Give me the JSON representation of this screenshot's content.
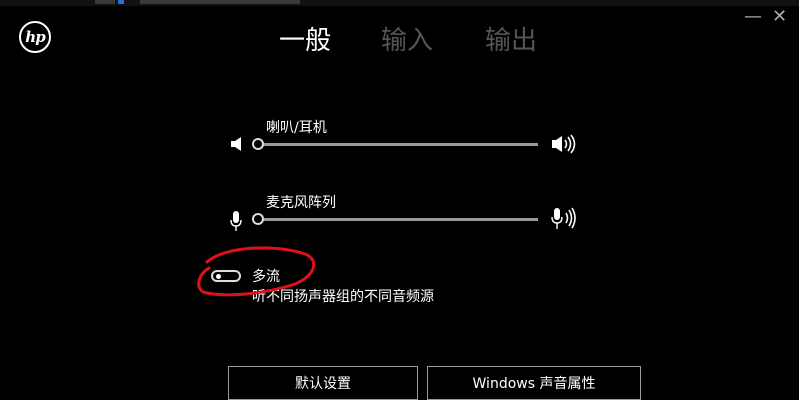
{
  "brand": {
    "logo_text": "hp"
  },
  "window_controls": {
    "minimize": "—",
    "close": "✕"
  },
  "tabs": [
    {
      "label": "一般",
      "active": true
    },
    {
      "label": "输入",
      "active": false
    },
    {
      "label": "输出",
      "active": false
    }
  ],
  "speaker": {
    "label": "喇叭/耳机"
  },
  "microphone": {
    "label": "麦克风阵列"
  },
  "multistream": {
    "label": "多流",
    "description": "听不同扬声器组的不同音频源",
    "enabled": false
  },
  "buttons": {
    "default": "默认设置",
    "windows_sound": "Windows 声音属性"
  },
  "icons": {
    "speaker_low": "speaker-low-icon",
    "speaker_high": "speaker-high-icon",
    "mic_low": "microphone-low-icon",
    "mic_high": "microphone-high-icon"
  },
  "colors": {
    "background": "#000000",
    "text": "#ffffff",
    "inactive_tab": "#555555",
    "annotation": "#e0101a"
  }
}
